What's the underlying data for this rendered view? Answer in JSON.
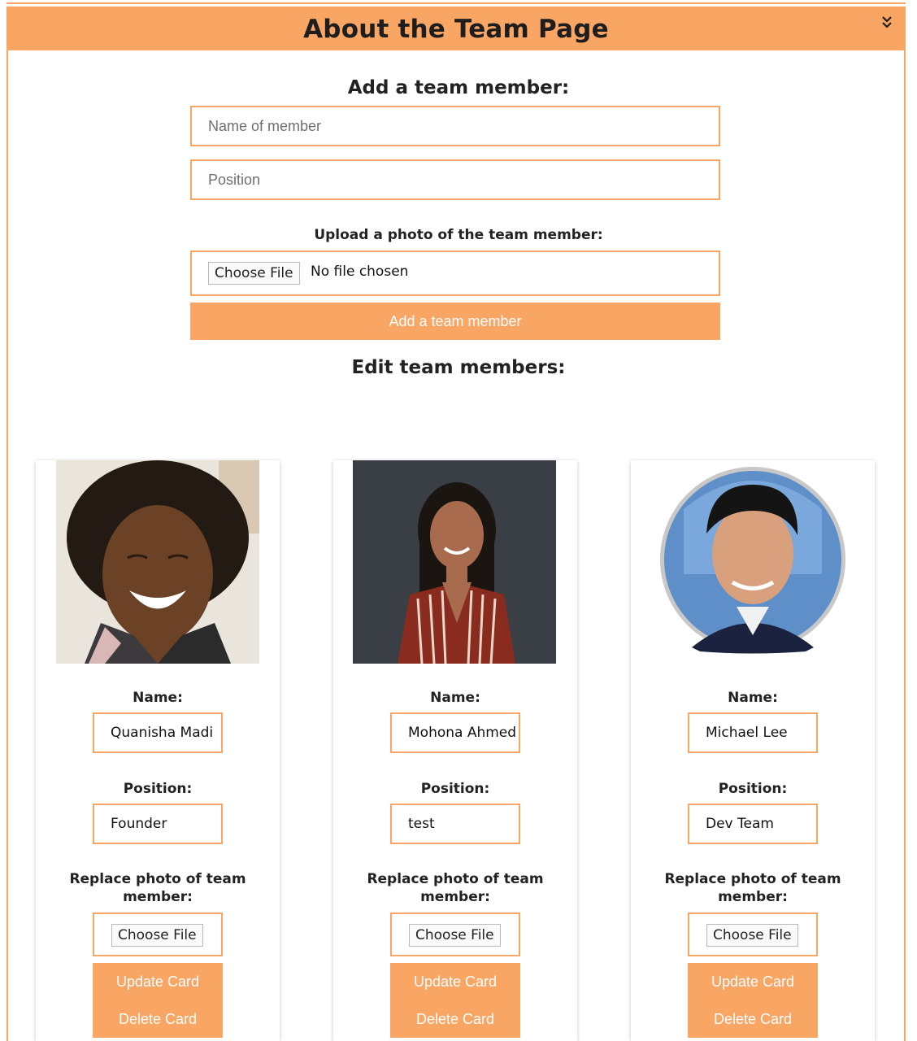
{
  "header": {
    "title": "About the Team Page",
    "collapse_icon": "double-chevron-down-icon"
  },
  "add_form": {
    "heading": "Add a team member:",
    "name_placeholder": "Name of member",
    "position_placeholder": "Position",
    "upload_label": "Upload a photo of the team member:",
    "choose_file_label": "Choose File",
    "file_status": "No file chosen",
    "submit_label": "Add a team member"
  },
  "edit_heading": "Edit team members:",
  "colors": {
    "accent": "#f9a564"
  },
  "members": [
    {
      "name_label": "Name:",
      "name": "Quanisha Madi",
      "position_label": "Position:",
      "position": "Founder",
      "replace_label": "Replace photo of team member:",
      "choose_file_label": "Choose File",
      "update_label": "Update Card",
      "delete_label": "Delete Card"
    },
    {
      "name_label": "Name:",
      "name": "Mohona Ahmed",
      "position_label": "Position:",
      "position": "test",
      "replace_label": "Replace photo of team member:",
      "choose_file_label": "Choose File",
      "update_label": "Update Card",
      "delete_label": "Delete Card"
    },
    {
      "name_label": "Name:",
      "name": "Michael Lee",
      "position_label": "Position:",
      "position": "Dev Team",
      "replace_label": "Replace photo of team member:",
      "choose_file_label": "Choose File",
      "update_label": "Update Card",
      "delete_label": "Delete Card"
    }
  ]
}
